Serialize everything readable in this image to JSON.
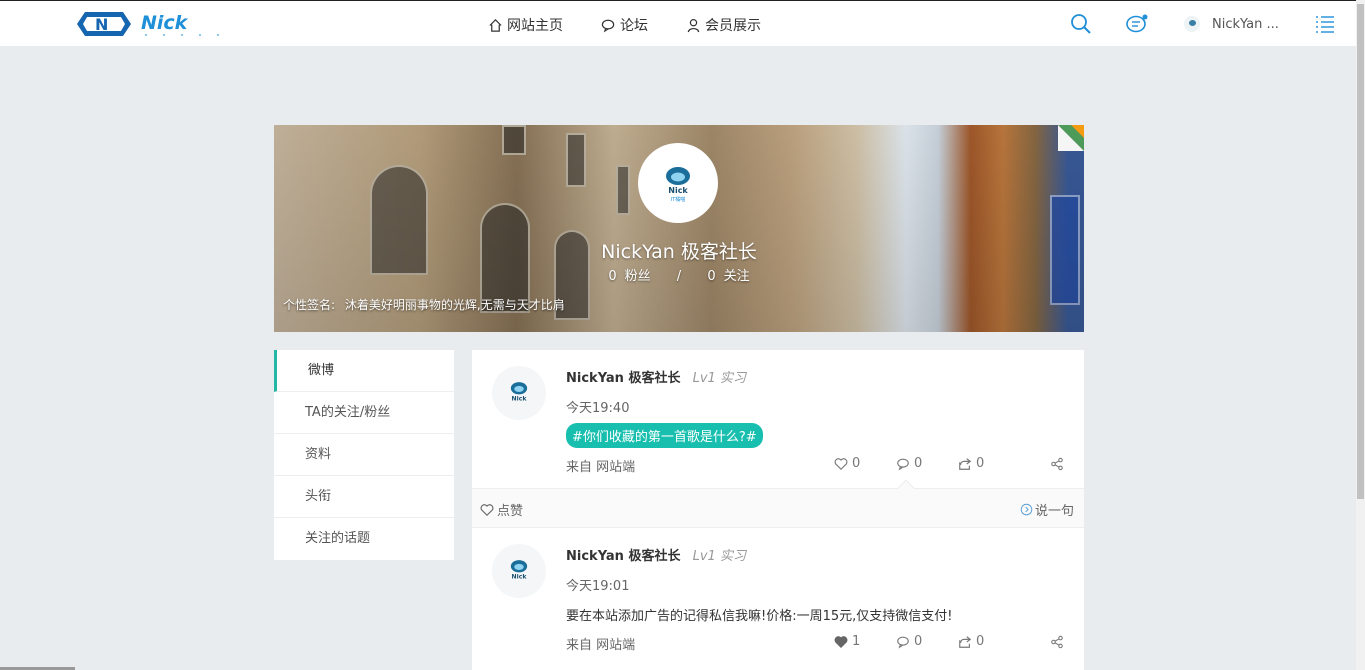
{
  "nav": {
    "logo_text": "Nick",
    "items": [
      {
        "label": "网站主页",
        "icon": "home-icon"
      },
      {
        "label": "论坛",
        "icon": "chat-icon"
      },
      {
        "label": "会员展示",
        "icon": "user-icon"
      }
    ],
    "user_name": "NickYan ..."
  },
  "banner": {
    "avatar_text": "Nick",
    "avatar_sub": "IT橘喵",
    "name": "NickYan 极客社长",
    "fans_count": "0",
    "fans_label": "粉丝",
    "separator": "/",
    "follow_count": "0",
    "follow_label": "关注",
    "signature_label": "个性签名:",
    "signature": "沐着美好明丽事物的光辉,无需与天才比肩"
  },
  "sidebar": {
    "items": [
      {
        "label": "微博",
        "active": true
      },
      {
        "label": "TA的关注/粉丝"
      },
      {
        "label": "资料"
      },
      {
        "label": "头衔"
      },
      {
        "label": "关注的话题"
      }
    ]
  },
  "posts": [
    {
      "author": "NickYan 极客社长",
      "level": "Lv1 实习",
      "time": "今天19:40",
      "topic": "#你们收藏的第一首歌是什么?#",
      "source": "来自 网站端",
      "likes": "0",
      "comments": "0",
      "reposts": "0"
    },
    {
      "author": "NickYan 极客社长",
      "level": "Lv1 实习",
      "time": "今天19:01",
      "text": "要在本站添加广告的记得私信我嘛!价格:一周15元,仅支持微信支付!",
      "source": "来自 网站端",
      "likes": "1",
      "comments": "0",
      "reposts": "0"
    }
  ],
  "like_bar": {
    "like_label": "点赞",
    "say_label": "说一句"
  },
  "colors": {
    "accent": "#18bfae",
    "nav_blue": "#1f8fd8",
    "logo_blue": "#1565b0"
  }
}
